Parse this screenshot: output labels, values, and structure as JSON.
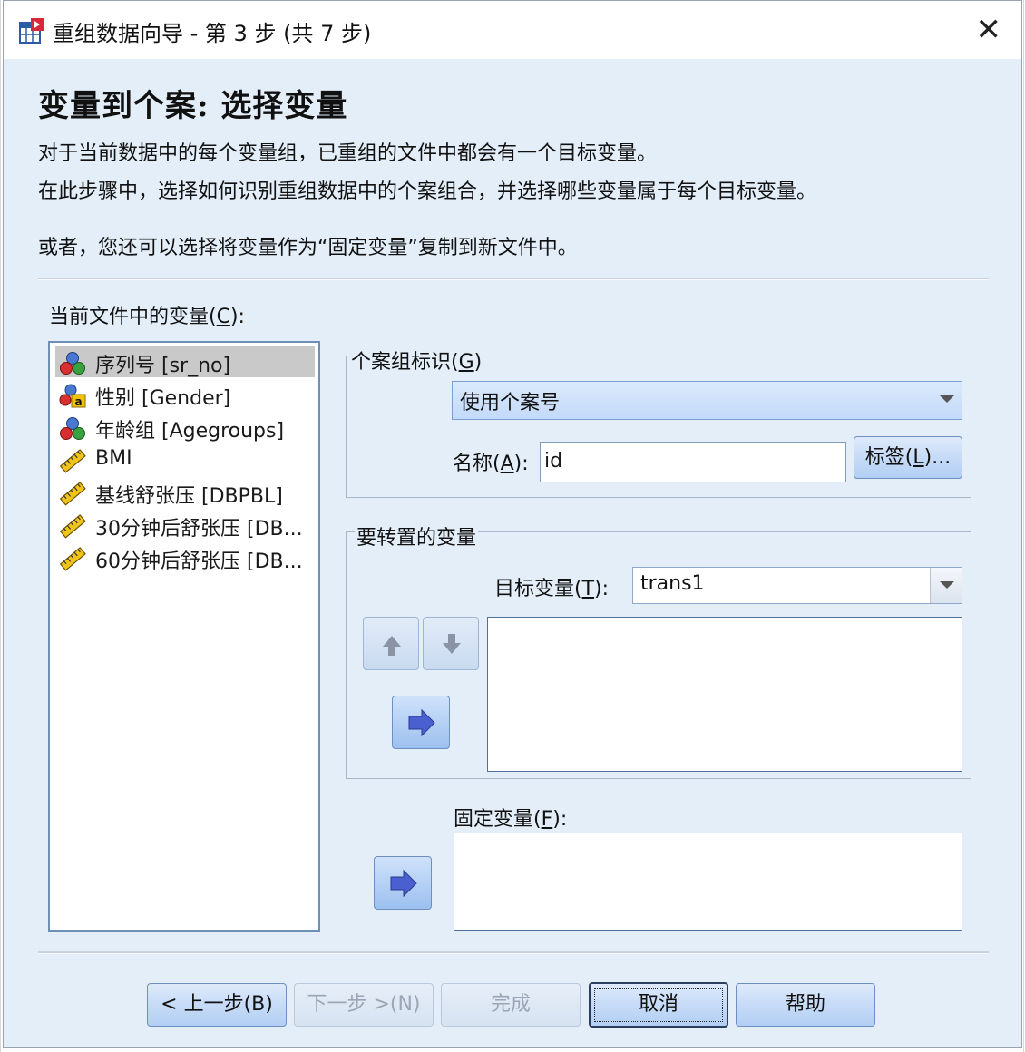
{
  "window": {
    "title": "重组数据向导 - 第 3 步 (共 7 步)",
    "close_glyph": "✕"
  },
  "heading": "变量到个案: 选择变量",
  "description": {
    "line1": "对于当前数据中的每个变量组，已重组的文件中都会有一个目标变量。",
    "line2": "在此步骤中，选择如何识别重组数据中的个案组合，并选择哪些变量属于每个目标变量。",
    "line3": "或者，您还可以选择将变量作为“固定变量”复制到新文件中。"
  },
  "variables_list": {
    "label_prefix": "当前文件中的变量(",
    "label_key": "C",
    "label_suffix": "):",
    "items": [
      {
        "label": "序列号 [sr_no]",
        "icon": "nominal-icon",
        "selected": true
      },
      {
        "label": "性别 [Gender]",
        "icon": "nominal-string-icon",
        "selected": false
      },
      {
        "label": "年龄组 [Agegroups]",
        "icon": "nominal-icon",
        "selected": false
      },
      {
        "label": "BMI",
        "icon": "scale-ruler-icon",
        "selected": false
      },
      {
        "label": "基线舒张压 [DBPBL]",
        "icon": "scale-ruler-icon",
        "selected": false
      },
      {
        "label": "30分钟后舒张压 [DB...",
        "icon": "scale-ruler-icon",
        "selected": false
      },
      {
        "label": "60分钟后舒张压 [DB...",
        "icon": "scale-ruler-icon",
        "selected": false
      }
    ]
  },
  "case_group_id": {
    "title_prefix": "个案组标识(",
    "title_key": "G",
    "title_suffix": ")",
    "method_value": "使用个案号",
    "name_label_prefix": "名称(",
    "name_label_key": "A",
    "name_label_suffix": "):",
    "name_value": "id",
    "label_button_prefix": "标签(",
    "label_button_key": "L",
    "label_button_suffix": ")..."
  },
  "transpose_vars": {
    "title": "要转置的变量",
    "target_label_prefix": "目标变量(",
    "target_label_key": "T",
    "target_label_suffix": "):",
    "target_value": "trans1"
  },
  "fixed_vars": {
    "label_prefix": "固定变量(",
    "label_key": "F",
    "label_suffix": "):"
  },
  "footer": {
    "back_label": "< 上一步(B)",
    "next_label": "下一步 >(N)",
    "finish_label": "完成",
    "cancel_label": "取消",
    "help_label": "帮助"
  },
  "colors": {
    "dialog_bg": "#e3eef9",
    "button_blue": "#c6dbf7",
    "arrow_blue": "#4a5fd0"
  }
}
